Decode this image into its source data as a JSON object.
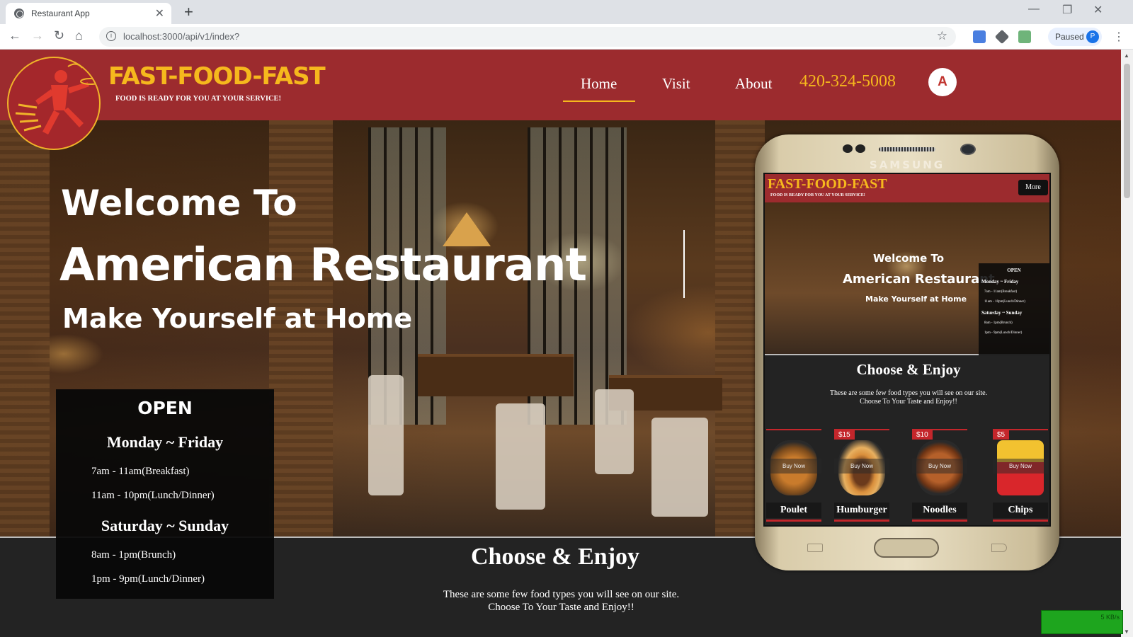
{
  "browser": {
    "tab_title": "Restaurant App",
    "tab_close": "✕",
    "new_tab": "+",
    "url": "localhost:3000/api/v1/index?",
    "profile_status": "Paused",
    "profile_initial": "P",
    "window_controls": {
      "minimize": "—",
      "restore": "❐",
      "close": "✕"
    }
  },
  "site": {
    "brand": "FAST-FOOD-FAST",
    "tagline": "FOOD IS READY FOR YOU AT YOUR SERVICE!",
    "nav": [
      {
        "label": "Home",
        "active": true
      },
      {
        "label": "Visit",
        "active": false
      },
      {
        "label": "About",
        "active": false
      }
    ],
    "phone": "420-324-5008",
    "user_initial": "A",
    "accent_color": "#9c2b2e",
    "brand_color": "#f6b81d"
  },
  "hero": {
    "line1": "Welcome To",
    "line2": "American Restaurant",
    "line3": "Make Yourself at Home"
  },
  "hours": {
    "title": "OPEN",
    "weekday_label": "Monday ~ Friday",
    "weekday_times": [
      "7am - 11am(Breakfast)",
      "11am - 10pm(Lunch/Dinner)"
    ],
    "weekend_label": "Saturday ~ Sunday",
    "weekend_times": [
      "8am - 1pm(Brunch)",
      "1pm - 9pm(Lunch/Dinner)"
    ]
  },
  "choose": {
    "title": "Choose & Enjoy",
    "line1": "These are some few food types you will see on our site.",
    "line2": "Choose To Your Taste and Enjoy!!"
  },
  "phone_mockup": {
    "device_brand": "SAMSUNG",
    "more_button": "More",
    "foods": [
      {
        "name": "Poulet",
        "price": "",
        "buy": "Buy Now"
      },
      {
        "name": "Humburger",
        "price": "$15",
        "buy": "Buy Now"
      },
      {
        "name": "Noodles",
        "price": "$10",
        "buy": "Buy Now"
      },
      {
        "name": "Chips",
        "price": "$5",
        "buy": "Buy Now"
      }
    ]
  },
  "net_widget": {
    "speed": "5 KB/s"
  }
}
